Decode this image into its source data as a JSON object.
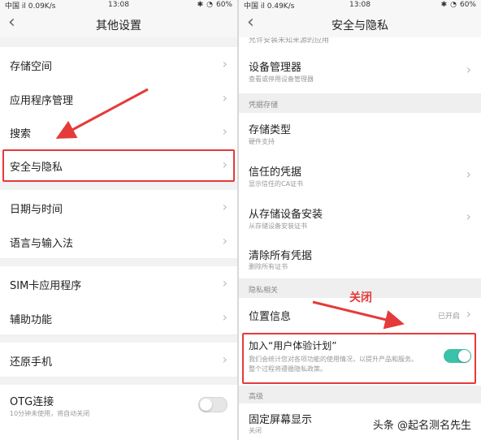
{
  "left": {
    "status": {
      "signal": "中国 il",
      "speed": "0.09K/s",
      "time": "13:08",
      "battery": "60%"
    },
    "title": "其他设置",
    "items": [
      {
        "label": "存储空间"
      },
      {
        "label": "应用程序管理"
      },
      {
        "label": "搜索"
      },
      {
        "label": "安全与隐私"
      },
      {
        "label": "日期与时间"
      },
      {
        "label": "语言与输入法"
      },
      {
        "label": "SIM卡应用程序"
      },
      {
        "label": "辅助功能"
      },
      {
        "label": "还原手机"
      },
      {
        "label": "OTG连接",
        "sub": "10分钟未使用，将自动关闭",
        "toggle": "off"
      }
    ]
  },
  "right": {
    "status": {
      "signal": "中国 il",
      "speed": "0.49K/s",
      "time": "13:08",
      "battery": "60%"
    },
    "title": "安全与隐私",
    "cut_text": "允许安装未知来源的应用",
    "items": [
      {
        "label": "设备管理器",
        "sub": "查看或停用设备管理器"
      },
      {
        "section": "凭据存储"
      },
      {
        "label": "存储类型",
        "sub": "硬件支持"
      },
      {
        "label": "信任的凭据",
        "sub": "显示信任的CA证书"
      },
      {
        "label": "从存储设备安装",
        "sub": "从存储设备安装证书"
      },
      {
        "label": "清除所有凭据",
        "sub": "删除所有证书"
      },
      {
        "section": "隐私相关"
      },
      {
        "label": "位置信息",
        "value": "已开启"
      },
      {
        "label": "加入“用户体验计划”",
        "sub": "我们会统计您对各项功能的使用情况，以提升产品和服务。整个过程将遵循隐私政策。",
        "toggle": "on"
      },
      {
        "section": "高级"
      },
      {
        "label": "固定屏幕显示",
        "sub": "关闭"
      }
    ],
    "annotation": "关闭"
  },
  "watermark": "头条 @起名测名先生",
  "colors": {
    "highlight": "#e53a3a",
    "toggle_on": "#3cc1ab"
  }
}
